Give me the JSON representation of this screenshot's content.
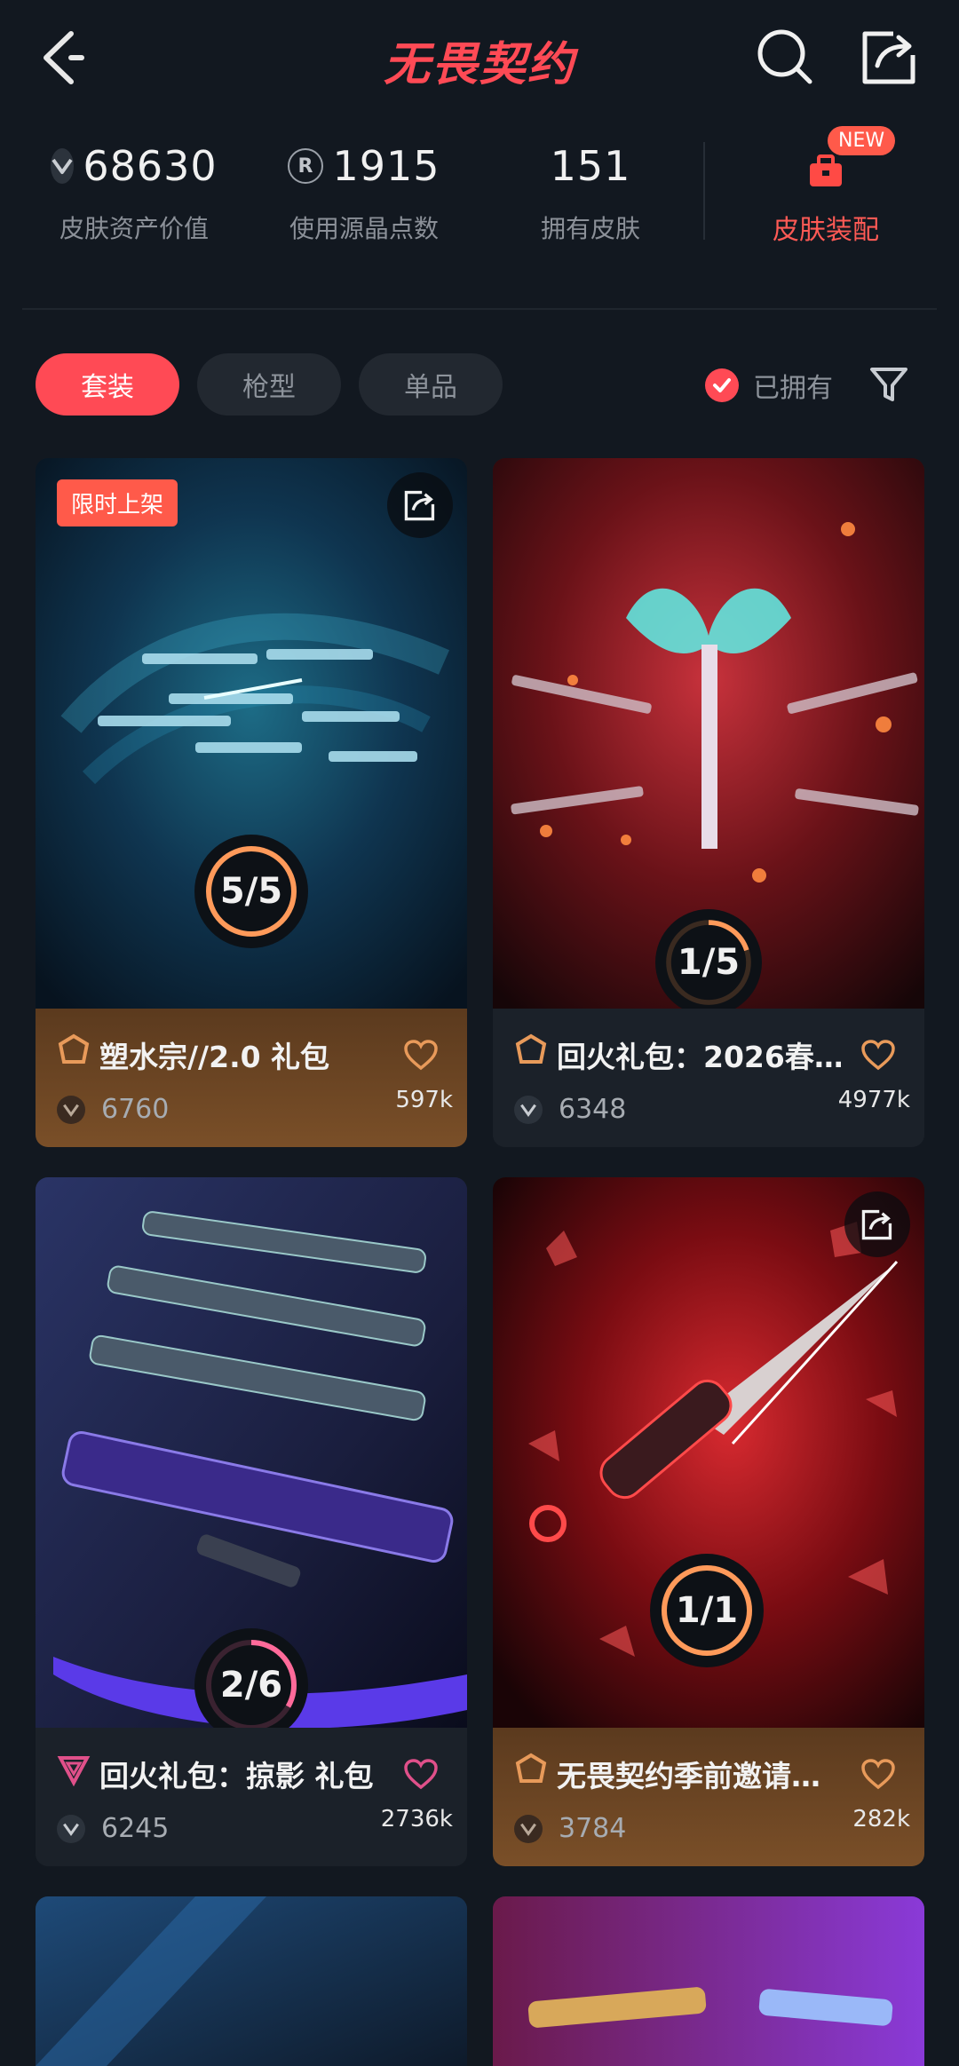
{
  "header": {
    "title": "无畏契约"
  },
  "stats": [
    {
      "value": "68630",
      "label": "皮肤资产价值",
      "icon": "valorant-points-icon"
    },
    {
      "value": "1915",
      "label": "使用源晶点数",
      "icon": "radianite-icon"
    },
    {
      "value": "151",
      "label": "拥有皮肤"
    }
  ],
  "equip": {
    "label": "皮肤装配",
    "badge": "NEW"
  },
  "filters": {
    "tabs": [
      "套装",
      "枪型",
      "单品"
    ],
    "active": "套装",
    "owned_label": "已拥有"
  },
  "cards": [
    {
      "name": "塑水宗//2.0 礼包",
      "price": "6760",
      "likes": "597k",
      "progress": "5/5",
      "owned": 5,
      "total": 5,
      "limited_tag": "限时上架",
      "tier_color": "#e89a5a",
      "footer": "gold"
    },
    {
      "name": "回火礼包：2026春…",
      "price": "6348",
      "likes": "4977k",
      "progress": "1/5",
      "owned": 1,
      "total": 5,
      "tier_color": "#e89a5a",
      "footer": "dark"
    },
    {
      "name": "回火礼包：掠影 礼包",
      "price": "6245",
      "likes": "2736k",
      "progress": "2/6",
      "owned": 2,
      "total": 6,
      "tier_color": "#e0508a",
      "footer": "dark"
    },
    {
      "name": "无畏契约季前邀请…",
      "price": "3784",
      "likes": "282k",
      "progress": "1/1",
      "owned": 1,
      "total": 1,
      "tier_color": "#e89a5a",
      "footer": "gold"
    }
  ],
  "colors": {
    "accent": "#ff4a55",
    "background": "#121820"
  }
}
